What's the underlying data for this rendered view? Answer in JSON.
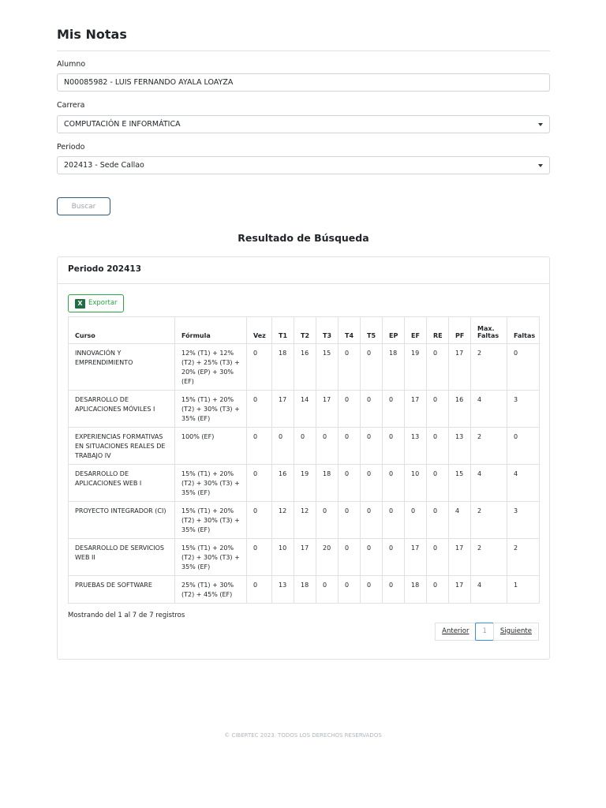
{
  "page": {
    "title": "Mis Notas"
  },
  "form": {
    "alumno_label": "Alumno",
    "alumno_value": "N00085982 - LUIS FERNANDO AYALA LOAYZA",
    "carrera_label": "Carrera",
    "carrera_value": "COMPUTACIÓN E INFORMÁTICA",
    "periodo_label": "Periodo",
    "periodo_value": "202413 - Sede Callao",
    "buscar_label": "Buscar"
  },
  "results": {
    "title": "Resultado de Búsqueda",
    "card_header": "Periodo 202413",
    "export_label": "Exportar",
    "columns": [
      "Curso",
      "Fórmula",
      "Vez",
      "T1",
      "T2",
      "T3",
      "T4",
      "T5",
      "EP",
      "EF",
      "RE",
      "PF",
      "Max. Faltas",
      "Faltas"
    ],
    "rows": [
      [
        "INNOVACIÓN Y EMPRENDIMIENTO",
        "12% (T1) + 12% (T2) + 25% (T3) + 20% (EP) + 30% (EF)",
        "0",
        "18",
        "16",
        "15",
        "0",
        "0",
        "18",
        "19",
        "0",
        "17",
        "2",
        "0"
      ],
      [
        "DESARROLLO DE APLICACIONES MÓVILES I",
        "15% (T1) + 20% (T2) + 30% (T3) + 35% (EF)",
        "0",
        "17",
        "14",
        "17",
        "0",
        "0",
        "0",
        "17",
        "0",
        "16",
        "4",
        "3"
      ],
      [
        "EXPERIENCIAS FORMATIVAS EN SITUACIONES REALES DE TRABAJO IV",
        "100% (EF)",
        "0",
        "0",
        "0",
        "0",
        "0",
        "0",
        "0",
        "13",
        "0",
        "13",
        "2",
        "0"
      ],
      [
        "DESARROLLO DE APLICACIONES WEB I",
        "15% (T1) + 20% (T2) + 30% (T3) + 35% (EF)",
        "0",
        "16",
        "19",
        "18",
        "0",
        "0",
        "0",
        "10",
        "0",
        "15",
        "4",
        "4"
      ],
      [
        "PROYECTO INTEGRADOR (CI)",
        "15% (T1) + 20% (T2) + 30% (T3) + 35% (EF)",
        "0",
        "12",
        "12",
        "0",
        "0",
        "0",
        "0",
        "0",
        "0",
        "4",
        "2",
        "3"
      ],
      [
        "DESARROLLO DE SERVICIOS WEB II",
        "15% (T1) + 20% (T2) + 30% (T3) + 35% (EF)",
        "0",
        "10",
        "17",
        "20",
        "0",
        "0",
        "0",
        "17",
        "0",
        "17",
        "2",
        "2"
      ],
      [
        "PRUEBAS DE SOFTWARE",
        "25% (T1) + 30% (T2) + 45% (EF)",
        "0",
        "13",
        "18",
        "0",
        "0",
        "0",
        "0",
        "18",
        "0",
        "17",
        "4",
        "1"
      ]
    ],
    "info": "Mostrando del 1 al 7 de 7 registros",
    "pagination": {
      "prev": "Anterior",
      "current": "1",
      "next": "Siguiente"
    }
  },
  "footer": {
    "text": "© CIBERTEC 2023. TODOS LOS DERECHOS RESERVADOS"
  },
  "colors": {
    "export_green": "#28a745",
    "excel_green": "#1d6f42",
    "buscar_border": "#2f5d7c",
    "active_page": "#3a8fd8"
  }
}
